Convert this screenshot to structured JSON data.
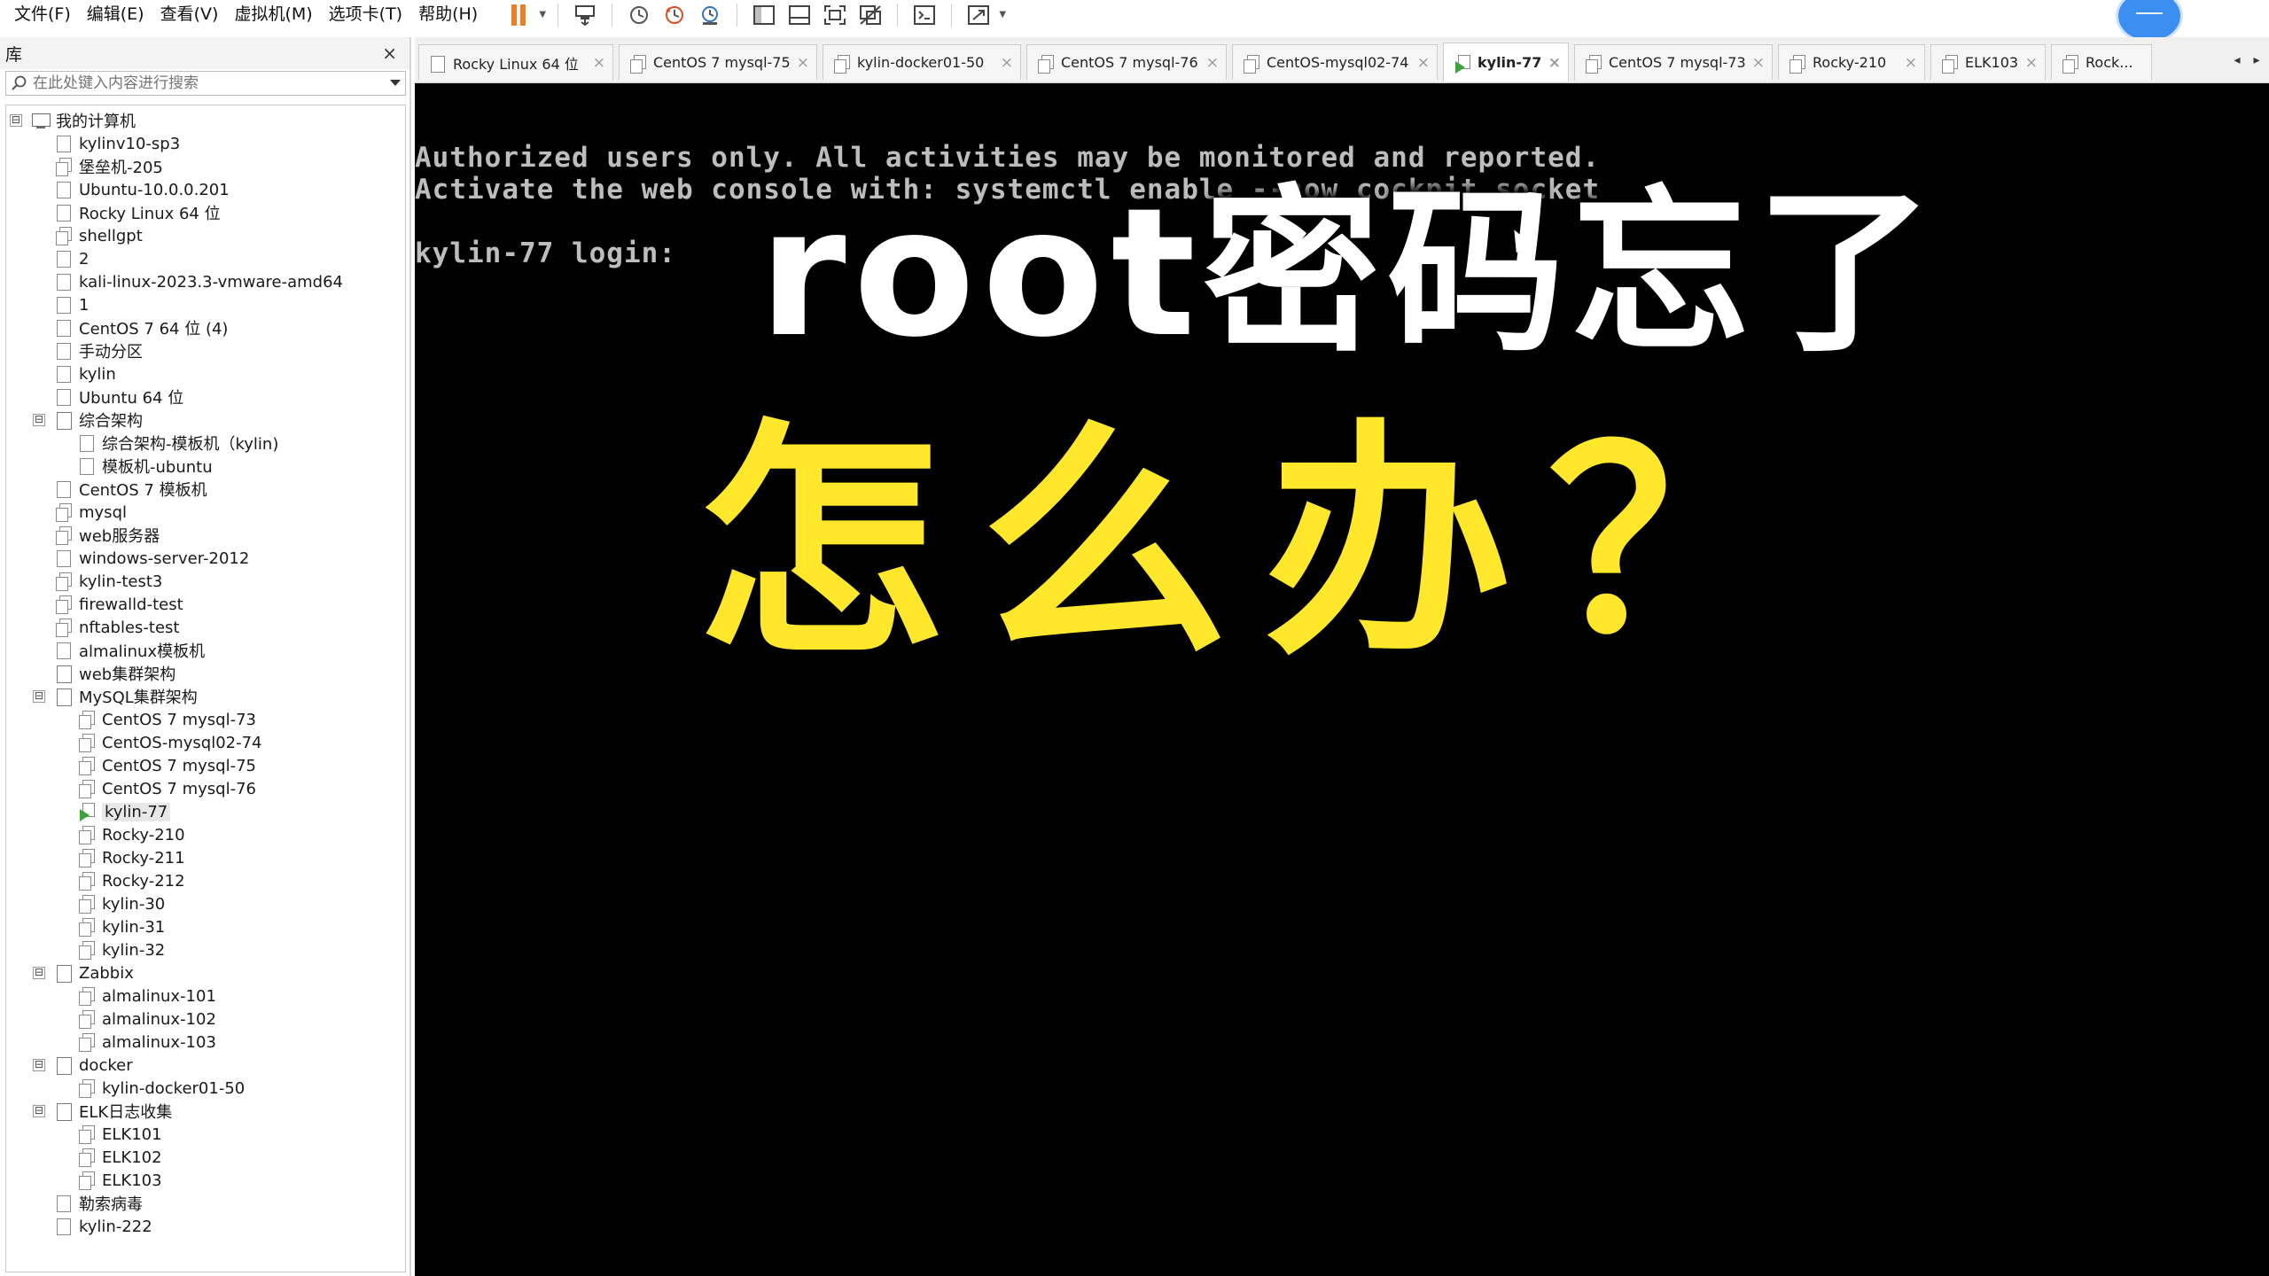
{
  "menu": {
    "items": [
      "文件(F)",
      "编辑(E)",
      "查看(V)",
      "虚拟机(M)",
      "选项卡(T)",
      "帮助(H)"
    ]
  },
  "toolbar": {
    "buttons": [
      {
        "icon": "pause-icon"
      },
      {
        "icon": "send-ctrl-alt-del-icon"
      },
      {
        "icon": "snapshot-icon"
      },
      {
        "icon": "revert-snapshot-icon"
      },
      {
        "icon": "snapshot-manager-icon"
      },
      {
        "icon": "library-view-icon"
      },
      {
        "icon": "thumbnail-view-icon"
      },
      {
        "icon": "fullscreen-icon"
      },
      {
        "icon": "unity-icon"
      },
      {
        "icon": "console-view-icon"
      },
      {
        "icon": "stretch-guest-icon"
      }
    ],
    "accent_color": "#f07d22"
  },
  "library": {
    "title": "库",
    "close": "×",
    "search_placeholder": "在此处键入内容进行搜索",
    "tree": [
      {
        "label": "我的计算机",
        "level": 0,
        "icon": "computer-icon",
        "expand": "⊟"
      },
      {
        "label": "kylinv10-sp3",
        "level": 1,
        "icon": "vm-icon"
      },
      {
        "label": "堡垒机-205",
        "level": 1,
        "icon": "vm-clone-icon"
      },
      {
        "label": "Ubuntu-10.0.0.201",
        "level": 1,
        "icon": "vm-icon"
      },
      {
        "label": "Rocky Linux 64 位",
        "level": 1,
        "icon": "vm-icon"
      },
      {
        "label": "shellgpt",
        "level": 1,
        "icon": "vm-clone-icon"
      },
      {
        "label": "2",
        "level": 1,
        "icon": "vm-icon"
      },
      {
        "label": "kali-linux-2023.3-vmware-amd64",
        "level": 1,
        "icon": "vm-icon"
      },
      {
        "label": "1",
        "level": 1,
        "icon": "vm-icon"
      },
      {
        "label": "CentOS 7 64 位 (4)",
        "level": 1,
        "icon": "vm-icon"
      },
      {
        "label": "手动分区",
        "level": 1,
        "icon": "vm-icon"
      },
      {
        "label": "kylin",
        "level": 1,
        "icon": "vm-icon"
      },
      {
        "label": "Ubuntu 64 位",
        "level": 1,
        "icon": "vm-icon"
      },
      {
        "label": "综合架构",
        "level": 1,
        "icon": "folder-icon",
        "expand": "⊟"
      },
      {
        "label": "综合架构-模板机（kylin)",
        "level": 2,
        "icon": "vm-icon"
      },
      {
        "label": "模板机-ubuntu",
        "level": 2,
        "icon": "vm-icon"
      },
      {
        "label": "CentOS 7 模板机",
        "level": 1,
        "icon": "vm-icon"
      },
      {
        "label": "mysql",
        "level": 1,
        "icon": "vm-clone-icon"
      },
      {
        "label": "web服务器",
        "level": 1,
        "icon": "vm-clone-icon"
      },
      {
        "label": "windows-server-2012",
        "level": 1,
        "icon": "vm-icon"
      },
      {
        "label": "kylin-test3",
        "level": 1,
        "icon": "vm-clone-icon"
      },
      {
        "label": "firewalld-test",
        "level": 1,
        "icon": "vm-clone-icon"
      },
      {
        "label": "nftables-test",
        "level": 1,
        "icon": "vm-clone-icon"
      },
      {
        "label": "almalinux模板机",
        "level": 1,
        "icon": "vm-icon"
      },
      {
        "label": "web集群架构",
        "level": 1,
        "icon": "folder-icon"
      },
      {
        "label": "MySQL集群架构",
        "level": 1,
        "icon": "folder-icon",
        "expand": "⊟"
      },
      {
        "label": "CentOS 7 mysql-73",
        "level": 2,
        "icon": "vm-clone-icon"
      },
      {
        "label": "CentOS-mysql02-74",
        "level": 2,
        "icon": "vm-clone-icon"
      },
      {
        "label": "CentOS 7 mysql-75",
        "level": 2,
        "icon": "vm-clone-icon"
      },
      {
        "label": "CentOS 7 mysql-76",
        "level": 2,
        "icon": "vm-clone-icon"
      },
      {
        "label": "kylin-77",
        "level": 2,
        "icon": "vm-running-icon",
        "selected": true
      },
      {
        "label": "Rocky-210",
        "level": 2,
        "icon": "vm-clone-icon"
      },
      {
        "label": "Rocky-211",
        "level": 2,
        "icon": "vm-clone-icon"
      },
      {
        "label": "Rocky-212",
        "level": 2,
        "icon": "vm-clone-icon"
      },
      {
        "label": "kylin-30",
        "level": 2,
        "icon": "vm-clone-icon"
      },
      {
        "label": "kylin-31",
        "level": 2,
        "icon": "vm-clone-icon"
      },
      {
        "label": "kylin-32",
        "level": 2,
        "icon": "vm-clone-icon"
      },
      {
        "label": "Zabbix",
        "level": 1,
        "icon": "folder-icon",
        "expand": "⊟"
      },
      {
        "label": "almalinux-101",
        "level": 2,
        "icon": "vm-clone-icon"
      },
      {
        "label": "almalinux-102",
        "level": 2,
        "icon": "vm-clone-icon"
      },
      {
        "label": "almalinux-103",
        "level": 2,
        "icon": "vm-clone-icon"
      },
      {
        "label": "docker",
        "level": 1,
        "icon": "folder-icon",
        "expand": "⊟"
      },
      {
        "label": "kylin-docker01-50",
        "level": 2,
        "icon": "vm-clone-icon"
      },
      {
        "label": "ELK日志收集",
        "level": 1,
        "icon": "folder-icon",
        "expand": "⊟"
      },
      {
        "label": "ELK101",
        "level": 2,
        "icon": "vm-clone-icon"
      },
      {
        "label": "ELK102",
        "level": 2,
        "icon": "vm-clone-icon"
      },
      {
        "label": "ELK103",
        "level": 2,
        "icon": "vm-clone-icon"
      },
      {
        "label": "勒索病毒",
        "level": 1,
        "icon": "vm-icon"
      },
      {
        "label": "kylin-222",
        "level": 1,
        "icon": "vm-icon"
      }
    ]
  },
  "tabs": [
    {
      "label": "Rocky Linux 64 位",
      "icon": "vm-icon"
    },
    {
      "label": "CentOS 7 mysql-75",
      "icon": "vm-clone-icon"
    },
    {
      "label": "kylin-docker01-50",
      "icon": "vm-clone-icon"
    },
    {
      "label": "CentOS 7 mysql-76",
      "icon": "vm-clone-icon"
    },
    {
      "label": "CentOS-mysql02-74",
      "icon": "vm-clone-icon"
    },
    {
      "label": "kylin-77",
      "icon": "vm-running-icon",
      "active": true
    },
    {
      "label": "CentOS 7 mysql-73",
      "icon": "vm-clone-icon"
    },
    {
      "label": "Rocky-210",
      "icon": "vm-clone-icon"
    },
    {
      "label": "ELK103",
      "icon": "vm-clone-icon"
    },
    {
      "label": "Rock...",
      "icon": "vm-clone-icon"
    }
  ],
  "tab_close": "×",
  "tab_scroll_left": "◂",
  "tab_scroll_right": "▸",
  "console": {
    "lines": [
      "Authorized users only. All activities may be monitored and reported.",
      "Activate the web console with: systemctl enable --now cockpit.socket",
      "kylin-77 login:"
    ],
    "overlay_title": "root密码忘了",
    "overlay_subtitle": "怎么办？",
    "overlay_subtitle_color": "#ffe82b"
  }
}
